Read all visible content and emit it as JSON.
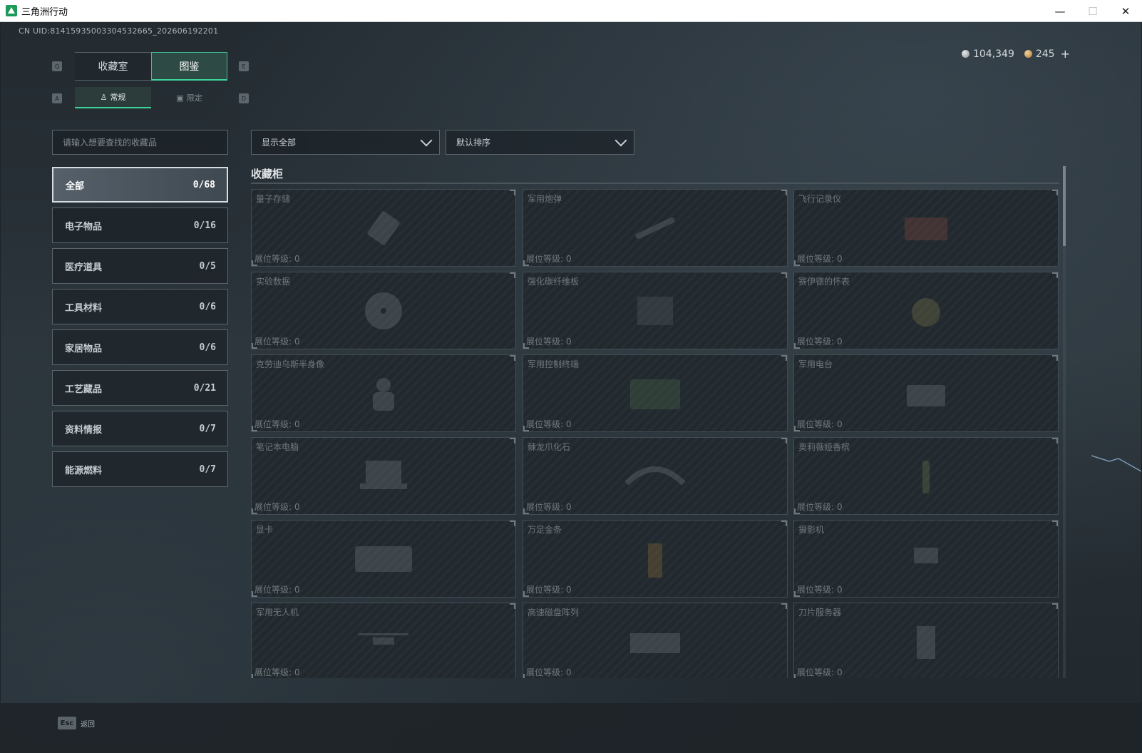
{
  "window": {
    "title": "三角洲行动",
    "controls": {
      "minimize": "—",
      "maximize": "☐",
      "close": "✕"
    }
  },
  "uid": "CN UID:8141593500330453266​5_202606192201",
  "currency": {
    "silver": "104,349",
    "gold": "245",
    "add": "+"
  },
  "main_tabs": [
    {
      "label": "收藏室",
      "key": "Q",
      "active": false
    },
    {
      "label": "图鉴",
      "key": "E",
      "active": true
    }
  ],
  "sub_tabs": [
    {
      "label": "常规",
      "icon": "figure-icon",
      "key": "A",
      "active": true
    },
    {
      "label": "限定",
      "icon": "image-icon",
      "key": "D",
      "active": false
    }
  ],
  "search": {
    "placeholder": "请输入想要查找的收藏品",
    "value": ""
  },
  "filters": {
    "show": "显示全部",
    "sort": "默认排序"
  },
  "categories": [
    {
      "label": "全部",
      "count": "0/68",
      "active": true
    },
    {
      "label": "电子物品",
      "count": "0/16"
    },
    {
      "label": "医疗道具",
      "count": "0/5"
    },
    {
      "label": "工具材料",
      "count": "0/6"
    },
    {
      "label": "家居物品",
      "count": "0/6"
    },
    {
      "label": "工艺藏品",
      "count": "0/21"
    },
    {
      "label": "资料情报",
      "count": "0/7"
    },
    {
      "label": "能源燃料",
      "count": "0/7"
    }
  ],
  "section_title": "收藏柜",
  "level_label": "展位等级:",
  "items": [
    {
      "name": "量子存储",
      "level": "0",
      "icon": "usb-drive-icon"
    },
    {
      "name": "军用炮弹",
      "level": "0",
      "icon": "shell-icon"
    },
    {
      "name": "飞行记录仪",
      "level": "0",
      "icon": "flight-recorder-icon"
    },
    {
      "name": "实验数据",
      "level": "0",
      "icon": "disc-icon"
    },
    {
      "name": "强化碳纤维板",
      "level": "0",
      "icon": "plate-icon"
    },
    {
      "name": "赛伊德的怀表",
      "level": "0",
      "icon": "pocket-watch-icon"
    },
    {
      "name": "克劳迪乌斯半身像",
      "level": "0",
      "icon": "bust-icon"
    },
    {
      "name": "军用控制终端",
      "level": "0",
      "icon": "terminal-icon"
    },
    {
      "name": "军用电台",
      "level": "0",
      "icon": "radio-icon"
    },
    {
      "name": "笔记本电脑",
      "level": "0",
      "icon": "laptop-icon"
    },
    {
      "name": "棘龙爪化石",
      "level": "0",
      "icon": "fossil-claw-icon"
    },
    {
      "name": "奥莉薇娅香槟",
      "level": "0",
      "icon": "champagne-icon"
    },
    {
      "name": "显卡",
      "level": "0",
      "icon": "gpu-icon"
    },
    {
      "name": "万足金条",
      "level": "0",
      "icon": "gold-bar-icon"
    },
    {
      "name": "摄影机",
      "level": "0",
      "icon": "camera-icon"
    },
    {
      "name": "军用无人机",
      "level": "0",
      "icon": "drone-icon"
    },
    {
      "name": "高速磁盘阵列",
      "level": "0",
      "icon": "disk-array-icon"
    },
    {
      "name": "刀片服务器",
      "level": "0",
      "icon": "server-icon"
    }
  ],
  "bottom": {
    "esc_key": "Esc",
    "back_label": "返回"
  }
}
